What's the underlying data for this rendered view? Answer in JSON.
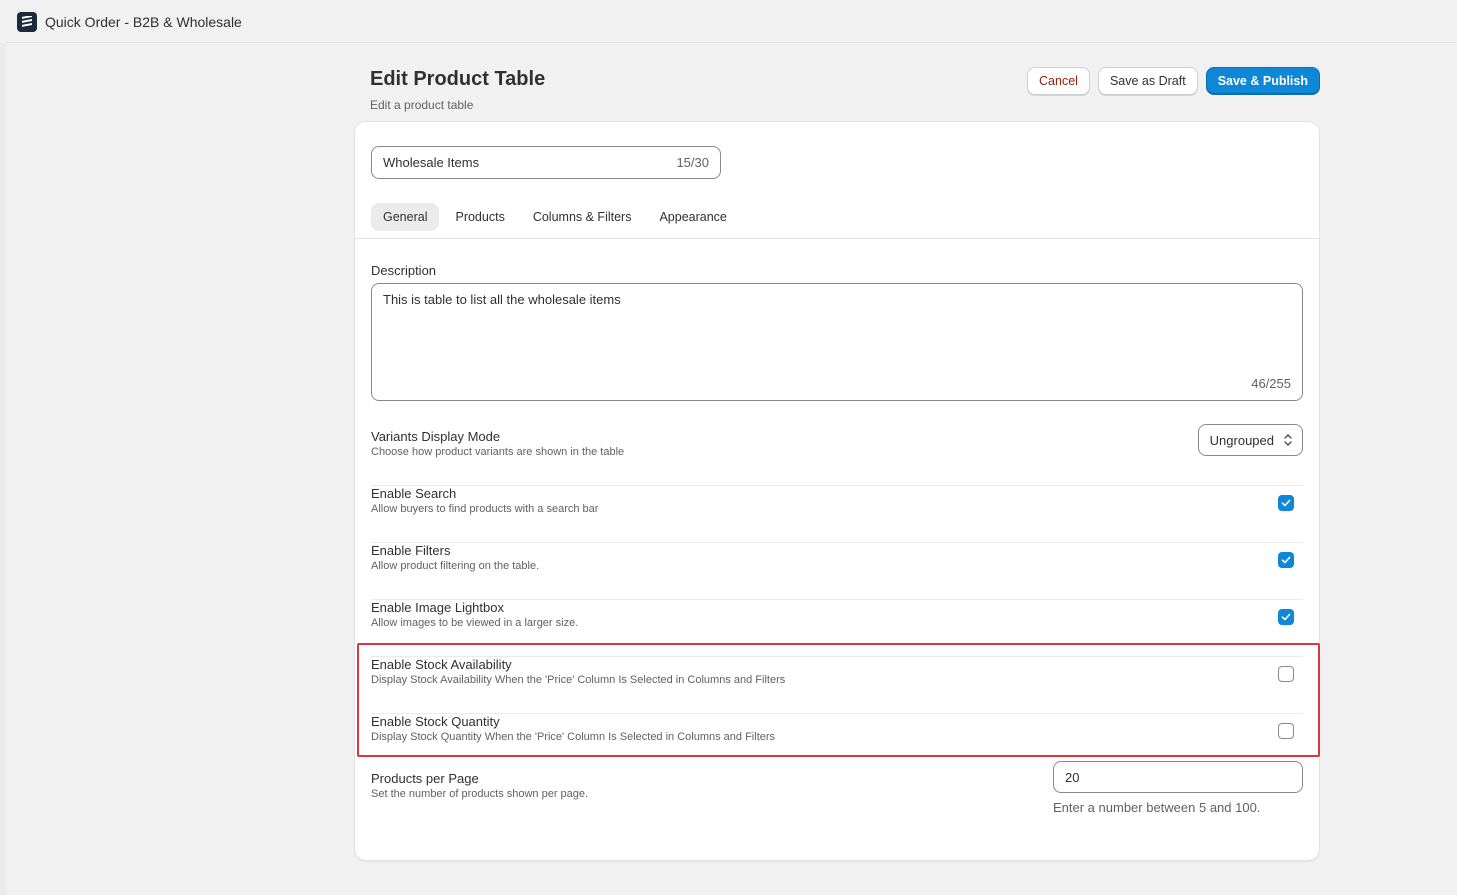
{
  "app": {
    "title": "Quick Order - B2B & Wholesale",
    "logo_icon": "stacked-bars-logo-icon"
  },
  "header": {
    "title": "Edit Product Table",
    "subtitle": "Edit a product table",
    "cancel_label": "Cancel",
    "draft_label": "Save as Draft",
    "publish_label": "Save & Publish"
  },
  "form": {
    "name_value": "Wholesale Items",
    "name_counter": "15/30",
    "tabs": [
      "General",
      "Products",
      "Columns & Filters",
      "Appearance"
    ],
    "active_tab": "General",
    "description_label": "Description",
    "description_value": "This is table to list all the wholesale items",
    "description_counter": "46/255",
    "variants": {
      "label": "Variants Display Mode",
      "help": "Choose how product variants are shown in the table",
      "value": "Ungrouped"
    },
    "settings": [
      {
        "label": "Enable Search",
        "help": "Allow buyers to find products with a search bar",
        "checked": true
      },
      {
        "label": "Enable Filters",
        "help": "Allow product filtering on the table.",
        "checked": true
      },
      {
        "label": "Enable Image Lightbox",
        "help": "Allow images to be viewed in a larger size.",
        "checked": true
      },
      {
        "label": "Enable Stock Availability",
        "help": "Display Stock Availability When the 'Price' Column Is Selected in Columns and Filters",
        "checked": false
      },
      {
        "label": "Enable Stock Quantity",
        "help": "Display Stock Quantity When the 'Price' Column Is Selected in Columns and Filters",
        "checked": false
      }
    ],
    "products_per_page": {
      "label": "Products per Page",
      "help": "Set the number of products shown per page.",
      "value": "20",
      "hint": "Enter a number between 5 and 100."
    }
  },
  "colors": {
    "accent": "#0f87d7",
    "highlight": "#d9363e",
    "cancel_text": "#8e1f0b"
  }
}
